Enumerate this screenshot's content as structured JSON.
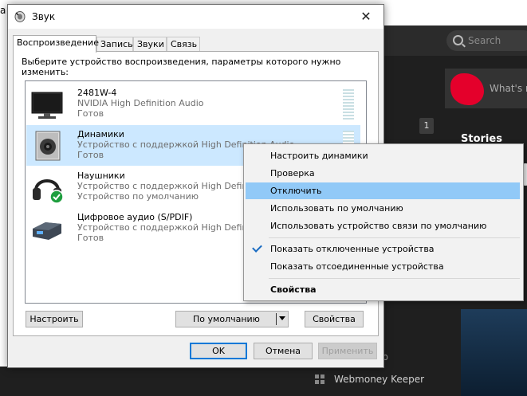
{
  "background": {
    "search_placeholder": "Search",
    "whats_text": "What's n",
    "badge_count": "1",
    "stories_label": "Stories",
    "fragment_op": "op",
    "fragment_s": "s",
    "webmoney_label": "Webmoney Keeper",
    "top_fragment": "a"
  },
  "dialog": {
    "title": "Звук",
    "close_glyph": "✕",
    "tabs": [
      {
        "label": "Воспроизведение",
        "active": true
      },
      {
        "label": "Запись",
        "active": false
      },
      {
        "label": "Звуки",
        "active": false
      },
      {
        "label": "Связь",
        "active": false
      }
    ],
    "instructions": "Выберите устройство воспроизведения, параметры которого нужно изменить:",
    "devices": [
      {
        "name": "2481W-4",
        "description": "NVIDIA High Definition Audio",
        "state": "Готов",
        "icon": "monitor-icon",
        "selected": false
      },
      {
        "name": "Динамики",
        "description": "Устройство с поддержкой High Definition Audio",
        "state": "Готов",
        "icon": "speaker-icon",
        "selected": true
      },
      {
        "name": "Наушники",
        "description": "Устройство с поддержкой High Definiti",
        "state": "Устройство по умолчанию",
        "icon": "headphones-icon",
        "selected": false
      },
      {
        "name": "Цифровое аудио (S/PDIF)",
        "description": "Устройство с поддержкой High Definiti",
        "state": "Готов",
        "icon": "spdif-icon",
        "selected": false
      }
    ],
    "buttons": {
      "configure": "Настроить",
      "set_default": "По умолчанию",
      "properties": "Свойства",
      "ok": "OK",
      "cancel": "Отмена",
      "apply": "Применить"
    }
  },
  "context_menu": {
    "items": [
      {
        "label": "Настроить динамики"
      },
      {
        "label": "Проверка"
      },
      {
        "label": "Отключить",
        "highlighted": true
      },
      {
        "label": "Использовать по умолчанию"
      },
      {
        "label": "Использовать устройство связи по умолчанию"
      },
      {
        "label": "Показать отключенные устройства",
        "checked": true
      },
      {
        "label": "Показать отсоединенные устройства"
      },
      {
        "label": "Свойства",
        "bold": true
      }
    ]
  },
  "colors": {
    "selection": "#cce8ff",
    "menu_highlight": "#91c9f7",
    "default_button_border": "#0078d7",
    "dark_background": "#1f1f1f",
    "avatar_red": "#e4002b"
  }
}
